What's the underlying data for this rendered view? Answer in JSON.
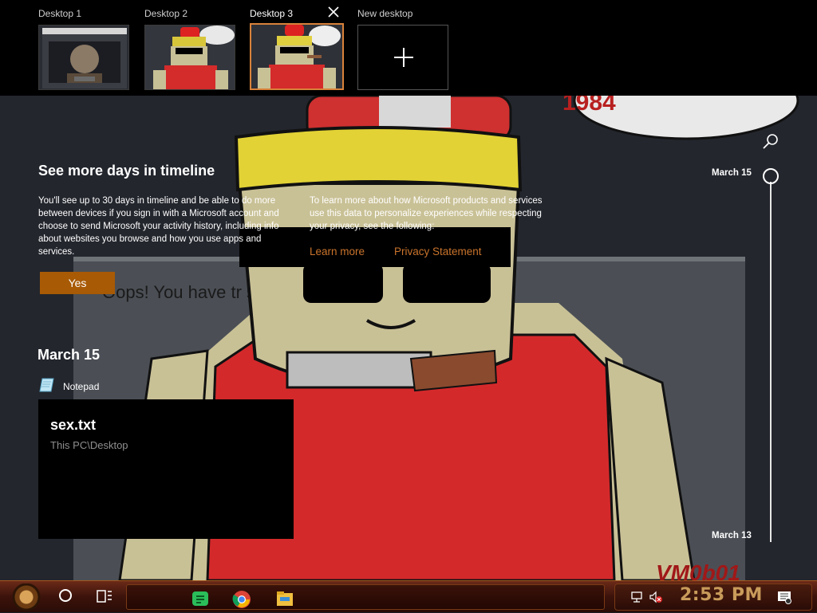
{
  "desktops": [
    {
      "label": "Desktop 1"
    },
    {
      "label": "Desktop 2"
    },
    {
      "label": "Desktop 3",
      "active": true
    },
    {
      "label": "New desktop"
    }
  ],
  "wallpaper": {
    "speech_bubble_text": "1984",
    "screen_text": "Oops! You have tr               s been deemed inappropriate:",
    "watermark": "VM0b01"
  },
  "timeline": {
    "prompt_title": "See more days in timeline",
    "prompt_body_left": "You'll see up to 30 days in timeline and be able to do more between devices if you sign in with a Microsoft account and choose to send Microsoft your activity history, including info about websites you browse and how you use apps and services.",
    "prompt_body_right": "To learn more about how Microsoft products and services use this data to personalize experiences while respecting your privacy, see the following:",
    "learn_more": "Learn more",
    "privacy_statement": "Privacy Statement",
    "yes_button": "Yes",
    "day_heading": "March 15",
    "app_name": "Notepad",
    "card": {
      "title": "sex.txt",
      "path": "This PC\\Desktop"
    },
    "scrubber_top_date": "March 15",
    "scrubber_bottom_date": "March 13"
  },
  "taskbar": {
    "apps": [
      "notes-app",
      "chrome",
      "file-explorer"
    ],
    "clock": "2:53 PM"
  },
  "colors": {
    "accent": "#a85a05",
    "link": "#c9732b",
    "taskbar": "#3c130b",
    "active_desktop_border": "#d9823a"
  }
}
